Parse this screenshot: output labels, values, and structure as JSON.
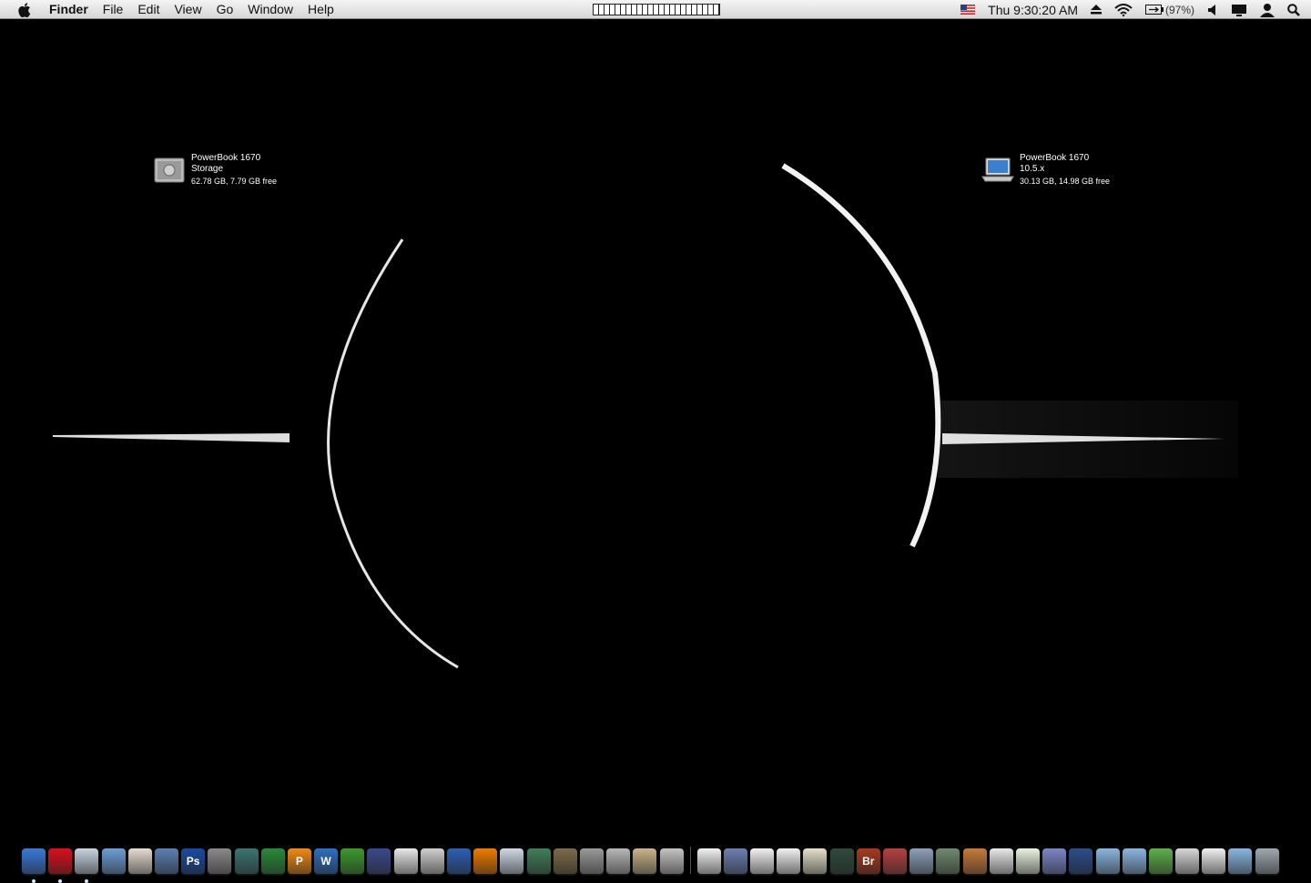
{
  "menubar": {
    "app_name": "Finder",
    "menus": [
      "File",
      "Edit",
      "View",
      "Go",
      "Window",
      "Help"
    ],
    "clock": "Thu 9:30:20 AM",
    "battery_percent": "(97%)",
    "status_icons": [
      "flag-us-icon",
      "eject-icon",
      "wifi-icon",
      "battery-icon",
      "volume-icon",
      "display-icon",
      "user-icon",
      "spotlight-icon"
    ]
  },
  "desktop": {
    "wallpaper": "black-starfield-ring-arcs",
    "icons": [
      {
        "name": "PowerBook 1670",
        "line2": "Storage",
        "info": "62.78 GB, 7.79 GB free",
        "icon": "external-drive-icon"
      },
      {
        "name": "PowerBook 1670",
        "line2": "10.5.x",
        "info": "30.13 GB, 14.98 GB free",
        "icon": "laptop-drive-icon"
      }
    ]
  },
  "dock": {
    "apps": [
      {
        "icon": "finder-icon",
        "color": "#3a78d8",
        "running": true
      },
      {
        "icon": "opera-icon",
        "color": "#d9101b",
        "running": true
      },
      {
        "icon": "preview-icon",
        "color": "#c8d4e0",
        "running": true
      },
      {
        "icon": "safari-icon",
        "color": "#6b9fd6",
        "running": false
      },
      {
        "icon": "photo-icon",
        "color": "#e5ddd2",
        "running": false
      },
      {
        "icon": "itunes-icon",
        "color": "#5d7fb0",
        "running": false
      },
      {
        "icon": "photoshop-icon",
        "color": "#1b4aa0",
        "label": "Ps",
        "running": false
      },
      {
        "icon": "camera-icon",
        "color": "#8a8a8a",
        "running": false
      },
      {
        "icon": "time-machine-icon",
        "color": "#3b7470",
        "running": false
      },
      {
        "icon": "chess-icon",
        "color": "#2a8a3a",
        "running": false
      },
      {
        "icon": "pages-icon",
        "color": "#f18a14",
        "label": "P",
        "running": false
      },
      {
        "icon": "word-icon",
        "color": "#2e6fc1",
        "label": "W",
        "running": false
      },
      {
        "icon": "excel-icon",
        "color": "#3c9a2c",
        "running": false
      },
      {
        "icon": "activity-graph-icon",
        "color": "#3a4a8c",
        "running": false
      },
      {
        "icon": "calendar-icon",
        "color": "#e9e9e9",
        "running": false
      },
      {
        "icon": "dvd-icon",
        "color": "#d0d0d0",
        "running": false
      },
      {
        "icon": "google-earth-icon",
        "color": "#2d5fb4",
        "running": false
      },
      {
        "icon": "vlc-icon",
        "color": "#ef7b00",
        "running": false
      },
      {
        "icon": "mail-icon",
        "color": "#cfd8e6",
        "running": false
      },
      {
        "icon": "image-viewer-icon",
        "color": "#3f7f5a",
        "running": false
      },
      {
        "icon": "iphoto-icon",
        "color": "#7d6a4a",
        "running": false
      },
      {
        "icon": "gear-icon",
        "color": "#9a9a9a",
        "running": false
      },
      {
        "icon": "calculator-icon",
        "color": "#b8b8b8",
        "running": false
      },
      {
        "icon": "book-icon",
        "color": "#c9b48a",
        "running": false
      },
      {
        "icon": "script-icon",
        "color": "#c4c4c4",
        "running": false
      },
      {
        "icon": "separator-icon",
        "color": "#555",
        "running": false
      },
      {
        "icon": "document-icon",
        "color": "#f2f2f2",
        "running": false
      },
      {
        "icon": "archive-icon",
        "color": "#6c7fb0",
        "running": false
      },
      {
        "icon": "document-icon",
        "color": "#f2f2f2",
        "running": false
      },
      {
        "icon": "document-icon",
        "color": "#f2f2f2",
        "running": false
      },
      {
        "icon": "notes-icon",
        "color": "#e5e0c8",
        "running": false
      },
      {
        "icon": "activity-monitor-icon",
        "color": "#2e4a3a",
        "running": false
      },
      {
        "icon": "bridge-icon",
        "color": "#a63a1e",
        "label": "Br",
        "running": false
      },
      {
        "icon": "printer-icon",
        "color": "#b54040",
        "running": false
      },
      {
        "icon": "phone-icon",
        "color": "#8ca0b8",
        "running": false
      },
      {
        "icon": "network-icon",
        "color": "#6f8a6f",
        "running": false
      },
      {
        "icon": "home-icon",
        "color": "#c87a3a",
        "running": false
      },
      {
        "icon": "pdf-icon",
        "color": "#e9e9e9",
        "running": false
      },
      {
        "icon": "spreadsheet-icon",
        "color": "#eaf4e0",
        "running": false
      },
      {
        "icon": "people-icon",
        "color": "#7a86c8",
        "running": false
      },
      {
        "icon": "wallpaper-icon",
        "color": "#2a4d8a",
        "running": false
      },
      {
        "icon": "folder-icon",
        "color": "#8ab6e0",
        "running": false
      },
      {
        "icon": "folder-icon",
        "color": "#8ab6e0",
        "running": false
      },
      {
        "icon": "downloads-icon",
        "color": "#5eb04a",
        "running": false
      },
      {
        "icon": "stop-icon",
        "color": "#d8d8d8",
        "running": false
      },
      {
        "icon": "text-file-icon",
        "color": "#f0f0f0",
        "running": false
      },
      {
        "icon": "folder-icon",
        "color": "#8ab6e0",
        "running": false
      },
      {
        "icon": "trash-icon",
        "color": "#a0a8b0",
        "running": false
      }
    ]
  }
}
